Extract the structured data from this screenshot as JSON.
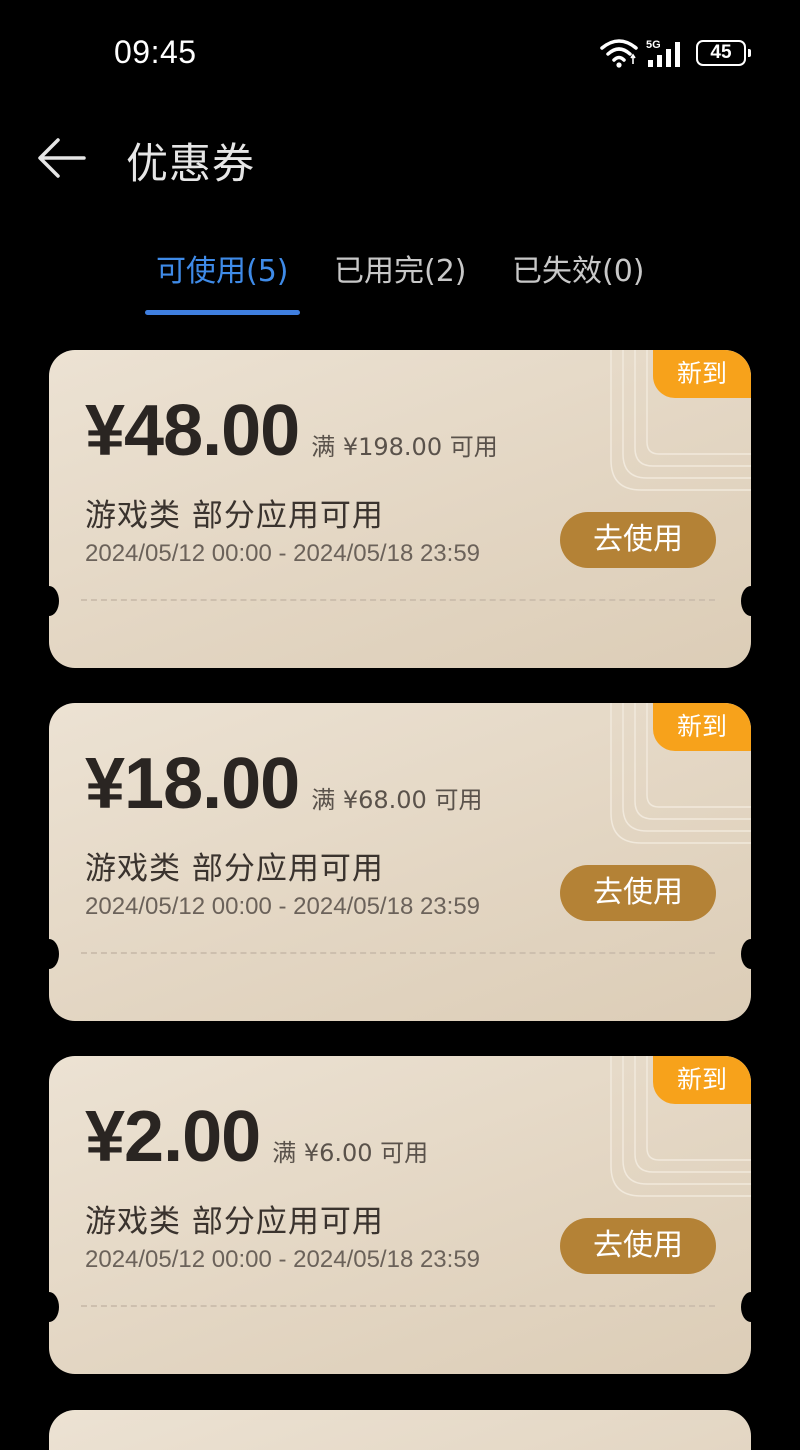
{
  "status_bar": {
    "time": "09:45",
    "battery": "45",
    "network": "5G"
  },
  "header": {
    "title": "优惠券"
  },
  "tabs": [
    {
      "label": "可使用(5)",
      "active": true
    },
    {
      "label": "已用完(2)",
      "active": false
    },
    {
      "label": "已失效(0)",
      "active": false
    }
  ],
  "coupons": [
    {
      "badge": "新到",
      "amount": "¥48.00",
      "condition": "满 ¥198.00 可用",
      "category": "游戏类 部分应用可用",
      "validity": "2024/05/12 00:00 - 2024/05/18 23:59",
      "button": "去使用"
    },
    {
      "badge": "新到",
      "amount": "¥18.00",
      "condition": "满 ¥68.00 可用",
      "category": "游戏类 部分应用可用",
      "validity": "2024/05/12 00:00 - 2024/05/18 23:59",
      "button": "去使用"
    },
    {
      "badge": "新到",
      "amount": "¥2.00",
      "condition": "满 ¥6.00 可用",
      "category": "游戏类 部分应用可用",
      "validity": "2024/05/12 00:00 - 2024/05/18 23:59",
      "button": "去使用"
    }
  ],
  "colors": {
    "accent_blue": "#3f8be8",
    "badge_orange": "#f7a21b",
    "button_gold": "#b48236",
    "card_beige": "#e6dac8"
  },
  "icons": {
    "back": "arrow-left-icon",
    "wifi": "wifi-icon",
    "signal": "signal-5g-icon",
    "battery": "battery-icon"
  }
}
